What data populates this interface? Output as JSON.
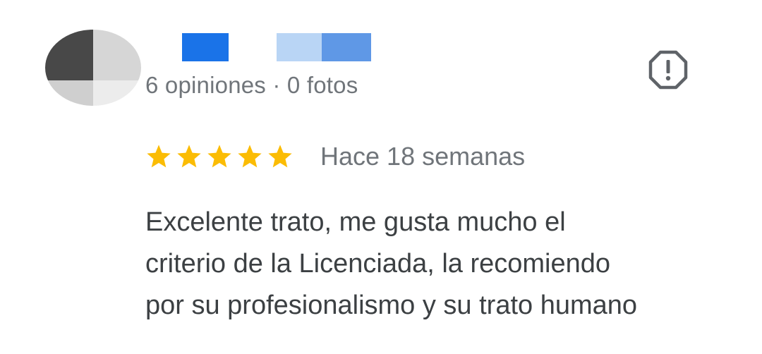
{
  "review": {
    "reviewer": {
      "avatar_icon": "user-avatar-obscured",
      "name_obscured": true,
      "meta_text": "6 opiniones · 0 fotos"
    },
    "flag_icon": "report-octagon-icon",
    "rating": {
      "stars": 5,
      "max_stars": 5,
      "star_color": "#fbbc04"
    },
    "time_ago": "Hace 18 semanas",
    "text_lines": [
      "Excelente trato, me gusta mucho el",
      "criterio de la Licenciada, la recomiendo",
      "por su profesionalismo y su trato humano"
    ]
  }
}
